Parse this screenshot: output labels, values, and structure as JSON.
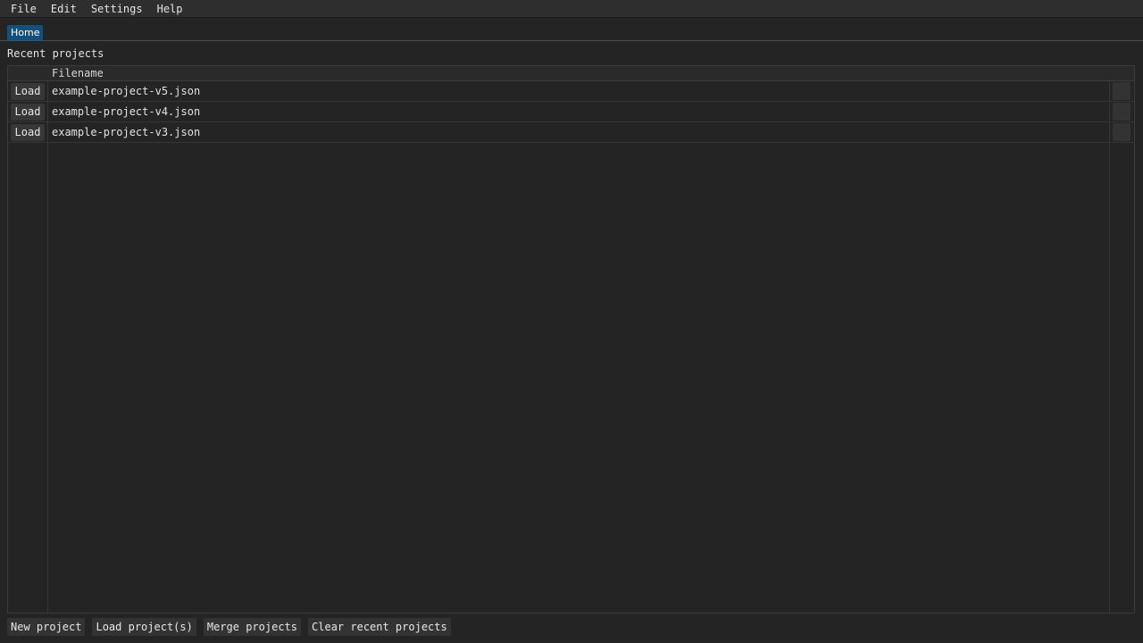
{
  "menubar": {
    "items": [
      {
        "label": "File"
      },
      {
        "label": "Edit"
      },
      {
        "label": "Settings"
      },
      {
        "label": "Help"
      }
    ]
  },
  "tabs": [
    {
      "label": "Home",
      "active": true
    }
  ],
  "recent": {
    "title": "Recent projects",
    "columns": [
      "",
      "Filename",
      ""
    ],
    "rows": [
      {
        "action": "Load",
        "filename": "example-project-v5.json"
      },
      {
        "action": "Load",
        "filename": "example-project-v4.json"
      },
      {
        "action": "Load",
        "filename": "example-project-v3.json"
      }
    ]
  },
  "footer": {
    "new_project": "New project",
    "load_projects": "Load project(s)",
    "merge_projects": "Merge projects",
    "clear_recent": "Clear recent projects"
  },
  "colors": {
    "background": "#242424",
    "accent": "#14507a",
    "button": "#373737"
  }
}
